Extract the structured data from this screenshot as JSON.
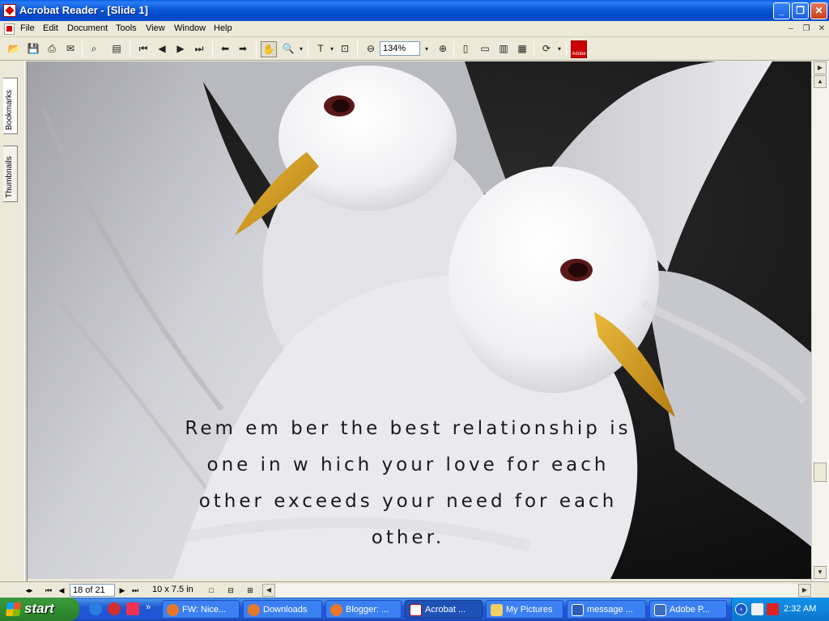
{
  "window": {
    "title": "Acrobat Reader - [Slide 1]"
  },
  "menu": [
    "File",
    "Edit",
    "Document",
    "Tools",
    "View",
    "Window",
    "Help"
  ],
  "toolbar": {
    "zoom": "134%"
  },
  "left_tabs": {
    "bookmarks": "Bookmarks",
    "thumbnails": "Thumbnails"
  },
  "slide": {
    "lines": [
      "Rem em ber the best relationship is",
      "one in w hich your love for each",
      "other exceeds your need for each",
      "other."
    ]
  },
  "status": {
    "page": "18 of 21",
    "page_size": "10 x 7.5 in"
  },
  "taskbar": {
    "start": "start",
    "tasks": [
      {
        "label": "FW: Nice...",
        "icon": "firefox-icon",
        "active": false
      },
      {
        "label": "Downloads",
        "icon": "firefox-icon",
        "active": false
      },
      {
        "label": "Blogger: ...",
        "icon": "firefox-icon",
        "active": false
      },
      {
        "label": "Acrobat ...",
        "icon": "acrobat-icon",
        "active": true
      },
      {
        "label": "My Pictures",
        "icon": "folder-icon",
        "active": false
      },
      {
        "label": "message ...",
        "icon": "word-icon",
        "active": false
      },
      {
        "label": "Adobe P...",
        "icon": "adobe-photoshop-icon",
        "active": false
      }
    ],
    "clock": "2:32 AM"
  },
  "colors": {
    "titlebar": "#0a58d8",
    "taskbar": "#2157d7",
    "start": "#2e8a2e",
    "beak": "#d9a020"
  }
}
